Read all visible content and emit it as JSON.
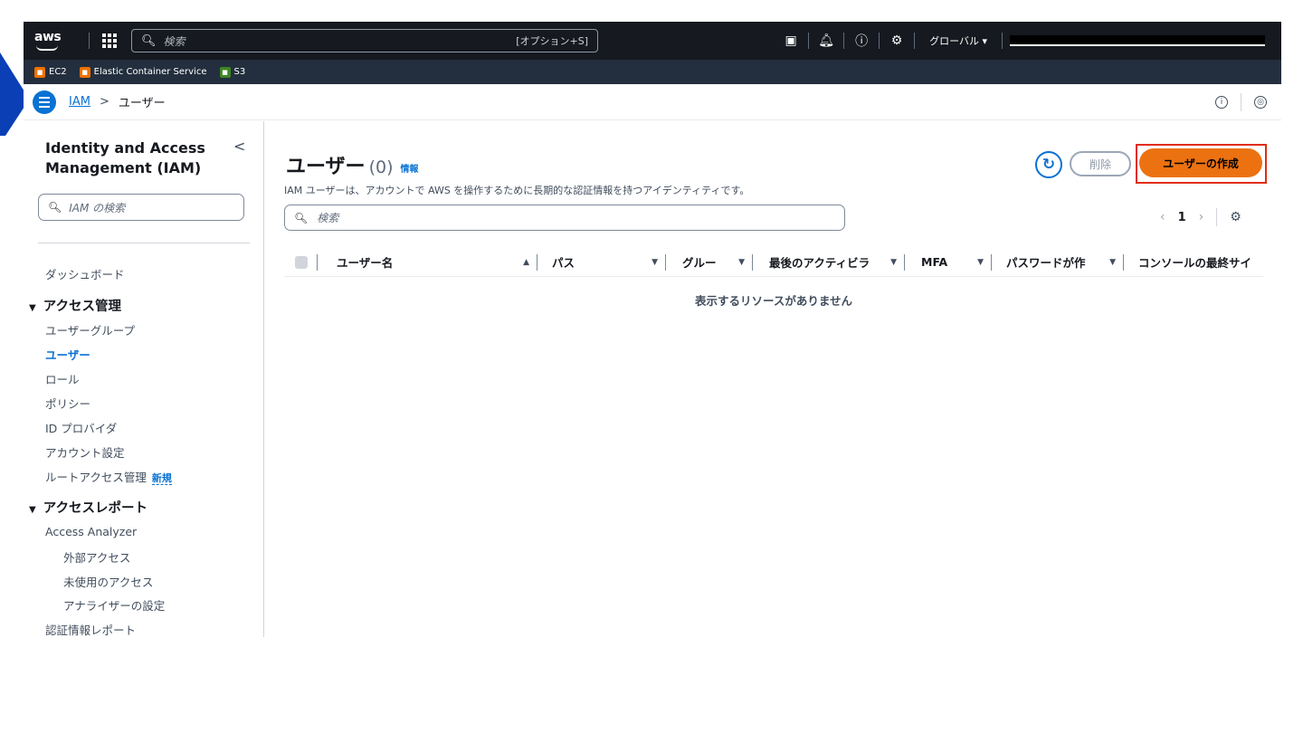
{
  "topnav": {
    "logo": "aws",
    "search_placeholder": "検索",
    "search_shortcut": "[オプション+S]",
    "region": "グローバル ▾"
  },
  "favorites": [
    {
      "label": "EC2",
      "color": "#ed7100"
    },
    {
      "label": "Elastic Container Service",
      "color": "#ed7100"
    },
    {
      "label": "S3",
      "color": "#3f8624"
    }
  ],
  "breadcrumb": {
    "parent": "IAM",
    "separator": ">",
    "current": "ユーザー"
  },
  "sidebar": {
    "title": "Identity and Access Management (IAM)",
    "collapse_icon": "<",
    "search_placeholder": "IAM の検索",
    "dashboard": "ダッシュボード",
    "sections": [
      {
        "label": "アクセス管理",
        "items": [
          "ユーザーグループ",
          "ユーザー",
          "ロール",
          "ポリシー",
          "ID プロバイダ",
          "アカウント設定",
          "ルートアクセス管理"
        ]
      },
      {
        "label": "アクセスレポート",
        "items": [
          "Access Analyzer",
          "外部アクセス",
          "未使用のアクセス",
          "アナライザーの設定",
          "認証情報レポート"
        ]
      }
    ],
    "new_badge": "新規",
    "active_item": "ユーザー"
  },
  "main": {
    "title": "ユーザー",
    "count": "(0)",
    "info_link": "情報",
    "description": "IAM ユーザーは、アカウントで AWS を操作するために長期的な認証情報を持つアイデンティティです。",
    "delete_label": "削除",
    "create_label": "ユーザーの作成",
    "search_placeholder": "検索",
    "page_number": "1",
    "columns": [
      "ユーザー名",
      "パス",
      "グルー",
      "最後のアクティビラ",
      "MFA",
      "パスワードが作",
      "コンソールの最終サイ"
    ],
    "empty_message": "表示するリソースがありません"
  },
  "colors": {
    "nav_bg": "#16191f",
    "accent": "#0972d3",
    "primary_button": "#ec7211",
    "highlight": "#e02d13"
  }
}
